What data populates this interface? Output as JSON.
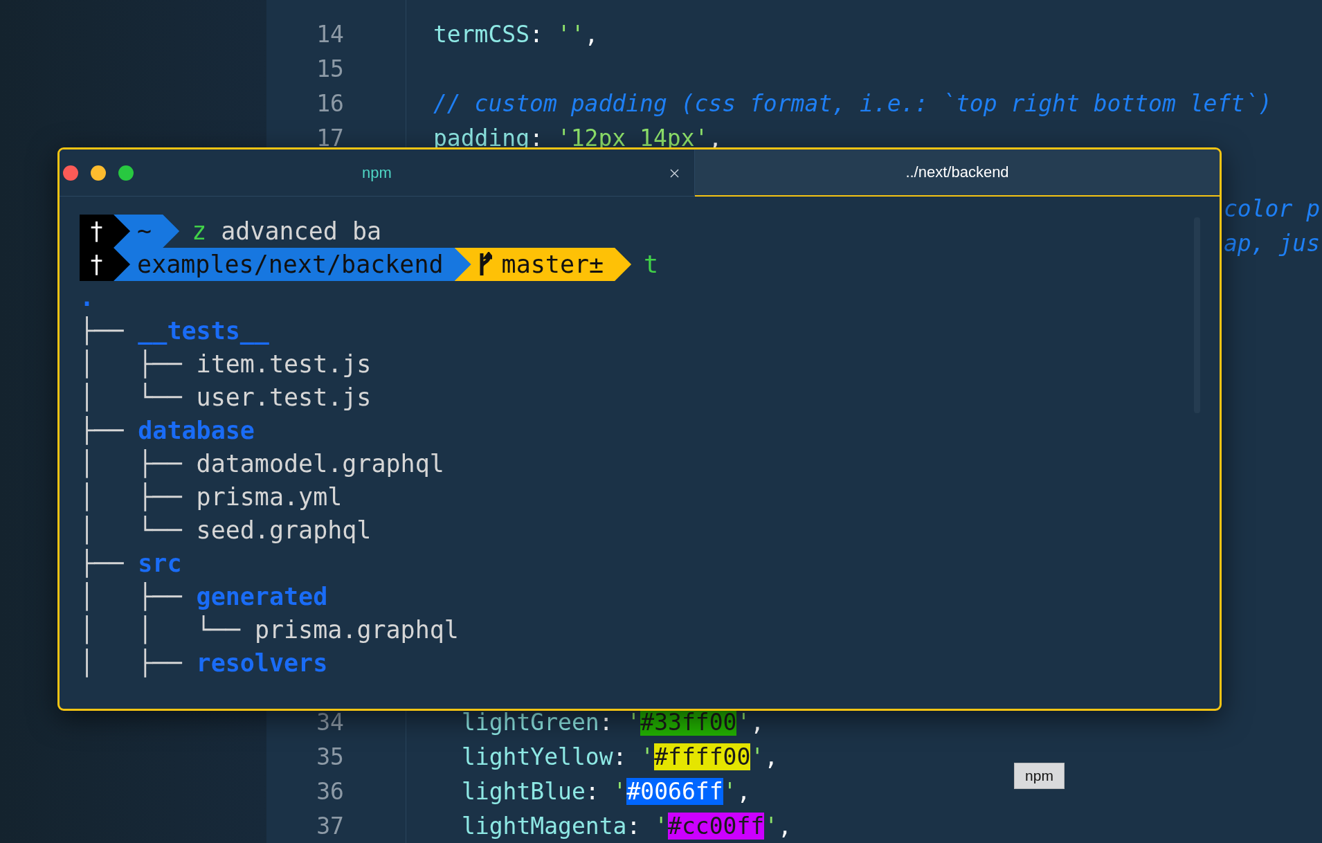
{
  "editor": {
    "top_lines": [
      {
        "number": "14",
        "tokens": [
          {
            "kind": "key",
            "text": "termCSS"
          },
          {
            "kind": "punct",
            "text": ": "
          },
          {
            "kind": "string",
            "text": "''"
          },
          {
            "kind": "punct",
            "text": ","
          }
        ]
      },
      {
        "number": "15"
      },
      {
        "number": "16",
        "tokens": [
          {
            "kind": "comment",
            "text": "// custom padding (css format, i.e.: `top right bottom left`)"
          }
        ]
      },
      {
        "number": "17",
        "tokens": [
          {
            "kind": "key",
            "text": "padding"
          },
          {
            "kind": "punct",
            "text": ": "
          },
          {
            "kind": "string",
            "text": "'12px 14px'"
          },
          {
            "kind": "punct",
            "text": ","
          }
        ]
      }
    ],
    "edge_lines": [
      {
        "tokens": [
          {
            "kind": "comment",
            "text": "color p"
          }
        ]
      },
      {
        "tokens": [
          {
            "kind": "comment",
            "text": "ap, jus"
          }
        ]
      }
    ],
    "bottom_lines": [
      {
        "number": "34",
        "tokens": [
          {
            "kind": "key",
            "text": "lightGreen"
          },
          {
            "kind": "punct",
            "text": ": "
          },
          {
            "kind": "string",
            "text": "'"
          },
          {
            "kind": "swatch",
            "text": "#33ff00",
            "color": "#22b000"
          },
          {
            "kind": "string",
            "text": "'"
          },
          {
            "kind": "punct",
            "text": ","
          }
        ]
      },
      {
        "number": "35",
        "tokens": [
          {
            "kind": "key",
            "text": "lightYellow"
          },
          {
            "kind": "punct",
            "text": ": "
          },
          {
            "kind": "string",
            "text": "'"
          },
          {
            "kind": "swatch",
            "text": "#ffff00",
            "color": "#e5e500"
          },
          {
            "kind": "string",
            "text": "'"
          },
          {
            "kind": "punct",
            "text": ","
          }
        ]
      },
      {
        "number": "36",
        "tokens": [
          {
            "kind": "key",
            "text": "lightBlue"
          },
          {
            "kind": "punct",
            "text": ": "
          },
          {
            "kind": "string",
            "text": "'"
          },
          {
            "kind": "swatch",
            "text": "#0066ff",
            "color": "#0066ff"
          },
          {
            "kind": "string",
            "text": "'"
          },
          {
            "kind": "punct",
            "text": ","
          }
        ]
      },
      {
        "number": "37",
        "tokens": [
          {
            "kind": "key",
            "text": "lightMagenta"
          },
          {
            "kind": "punct",
            "text": ": "
          },
          {
            "kind": "string",
            "text": "'"
          },
          {
            "kind": "swatch",
            "text": "#cc00ff",
            "color": "#cc00ff"
          },
          {
            "kind": "string",
            "text": "'"
          },
          {
            "kind": "punct",
            "text": ","
          }
        ]
      }
    ]
  },
  "terminal": {
    "tabs": [
      {
        "label": "npm",
        "selected": true,
        "closable": true
      },
      {
        "label": "../next/backend",
        "selected": false,
        "closable": false
      }
    ],
    "prompt_lines": [
      {
        "segments": [
          {
            "kind": "root",
            "text": "†"
          },
          {
            "kind": "dir",
            "text": "~"
          }
        ],
        "command": [
          {
            "kind": "cmd",
            "text": "z"
          },
          {
            "kind": "arg",
            "text": "advanced ba"
          }
        ]
      },
      {
        "segments": [
          {
            "kind": "root",
            "text": "†"
          },
          {
            "kind": "dir",
            "text": "examples/next/backend"
          },
          {
            "kind": "git",
            "text": "master±"
          }
        ],
        "command": [
          {
            "kind": "cmd",
            "text": "t"
          }
        ]
      }
    ],
    "tree": {
      "name": ".",
      "children": [
        {
          "guide": "├── ",
          "name": "__tests__",
          "kind": "dir",
          "children": [
            {
              "guide": "│   ├── ",
              "name": "item.test.js",
              "kind": "file"
            },
            {
              "guide": "│   └── ",
              "name": "user.test.js",
              "kind": "file"
            }
          ]
        },
        {
          "guide": "├── ",
          "name": "database",
          "kind": "dir",
          "children": [
            {
              "guide": "│   ├── ",
              "name": "datamodel.graphql",
              "kind": "file"
            },
            {
              "guide": "│   ├── ",
              "name": "prisma.yml",
              "kind": "file"
            },
            {
              "guide": "│   └── ",
              "name": "seed.graphql",
              "kind": "file"
            }
          ]
        },
        {
          "guide": "├── ",
          "name": "src",
          "kind": "dir",
          "children": [
            {
              "guide": "│   ├── ",
              "name": "generated",
              "kind": "dir",
              "children": [
                {
                  "guide": "│   │   └── ",
                  "name": "prisma.graphql",
                  "kind": "file"
                }
              ]
            },
            {
              "guide": "│   ├── ",
              "name": "resolvers",
              "kind": "dir"
            }
          ]
        }
      ]
    }
  },
  "tooltip": {
    "text": "npm"
  }
}
